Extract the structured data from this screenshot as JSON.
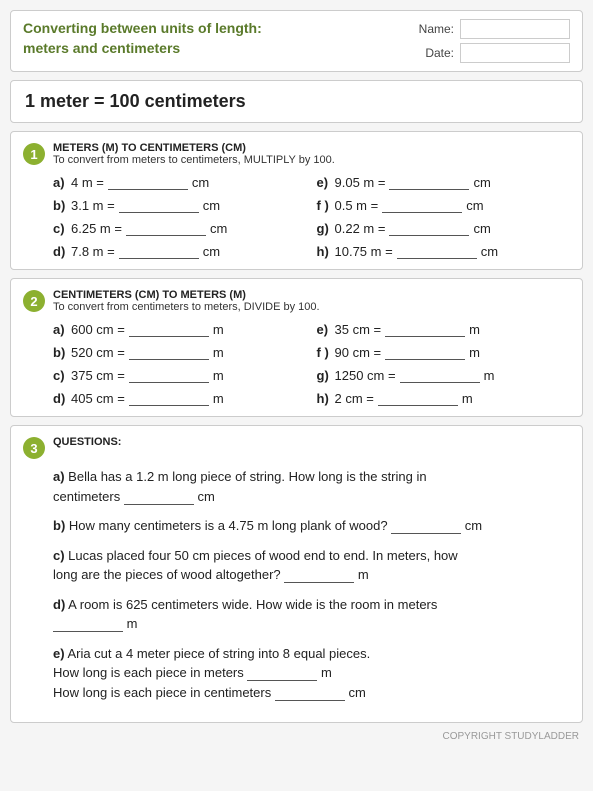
{
  "header": {
    "title_line1": "Converting between units of length:",
    "title_line2": "meters and centimeters",
    "name_label": "Name:",
    "date_label": "Date:"
  },
  "equiv": {
    "text": "1 meter = 100 centimeters"
  },
  "section1": {
    "number": "1",
    "title": "METERS (m) to CENTIMETERS (cm)",
    "instruction": "To convert from meters to centimeters, MULTIPLY by 100.",
    "problems": [
      {
        "label": "a)",
        "value": "4 m =",
        "unit": "cm"
      },
      {
        "label": "e)",
        "value": "9.05 m =",
        "unit": "cm"
      },
      {
        "label": "b)",
        "value": "3.1 m =",
        "unit": "cm"
      },
      {
        "label": "f )",
        "value": "0.5 m =",
        "unit": "cm"
      },
      {
        "label": "c)",
        "value": "6.25 m =",
        "unit": "cm"
      },
      {
        "label": "g)",
        "value": "0.22 m =",
        "unit": "cm"
      },
      {
        "label": "d)",
        "value": "7.8 m =",
        "unit": "cm"
      },
      {
        "label": "h)",
        "value": "10.75 m =",
        "unit": "cm"
      }
    ]
  },
  "section2": {
    "number": "2",
    "title": "CENTIMETERS (cm) to METERS (m)",
    "instruction": "To convert from centimeters to meters, DIVIDE by 100.",
    "problems": [
      {
        "label": "a)",
        "value": "600 cm =",
        "unit": "m"
      },
      {
        "label": "e)",
        "value": "35 cm =",
        "unit": "m"
      },
      {
        "label": "b)",
        "value": "520 cm =",
        "unit": "m"
      },
      {
        "label": "f )",
        "value": "90 cm =",
        "unit": "m"
      },
      {
        "label": "c)",
        "value": "375 cm =",
        "unit": "m"
      },
      {
        "label": "g)",
        "value": "1250 cm =",
        "unit": "m"
      },
      {
        "label": "d)",
        "value": "405 cm =",
        "unit": "m"
      },
      {
        "label": "h)",
        "value": "2 cm =",
        "unit": "m"
      }
    ]
  },
  "section3": {
    "number": "3",
    "title": "QUESTIONS:",
    "questions": [
      {
        "label": "a)",
        "text1": "Bella has a 1.2 m long piece of string. How long is the string in",
        "text2": "centimeters",
        "blank_unit": "cm",
        "type": "end_blank_newline"
      },
      {
        "label": "b)",
        "text1": "How many centimeters is a 4.75 m long plank of wood?",
        "blank_unit": "cm",
        "type": "inline_end"
      },
      {
        "label": "c)",
        "text1": "Lucas placed four 50 cm pieces of wood end to end. In meters, how",
        "text2": "long are the pieces of wood altogether?",
        "blank_unit": "m",
        "type": "inline_end_2line"
      },
      {
        "label": "d)",
        "text1": "A room is 625 centimeters wide. How wide is the room in meters",
        "blank_unit": "m",
        "type": "blank_start_newline"
      },
      {
        "label": "e)",
        "text1": "Aria cut a 4 meter piece of string into 8 equal pieces.",
        "text2": "How long is each piece in meters",
        "blank_unit2": "m",
        "text3": "How long is each piece in centimeters",
        "blank_unit3": "cm",
        "type": "multi"
      }
    ]
  },
  "copyright": "COPYRIGHT STUDYLADDER"
}
